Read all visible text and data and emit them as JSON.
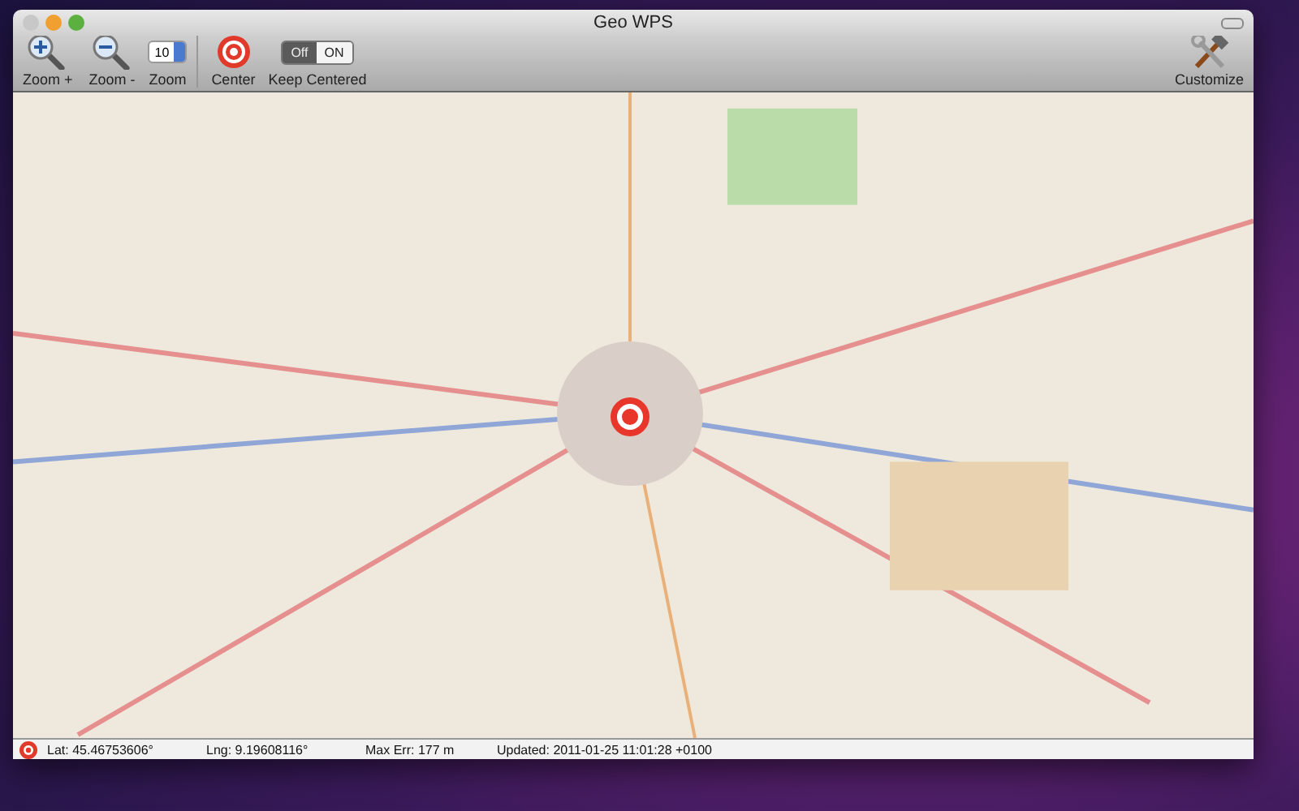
{
  "window": {
    "title": "Geo WPS"
  },
  "toolbar": {
    "items": [
      {
        "kind": "zoom-in",
        "label": "Zoom +"
      },
      {
        "kind": "zoom-out",
        "label": "Zoom -"
      },
      {
        "kind": "stepper",
        "label": "Zoom",
        "value": "10"
      },
      {
        "kind": "center",
        "label": "Center"
      },
      {
        "kind": "toggle",
        "label": "Keep Centered",
        "options": [
          {
            "label": "Off",
            "selected": true
          },
          {
            "label": "ON",
            "selected": false
          }
        ]
      }
    ],
    "customize": {
      "label": "Customize"
    }
  },
  "status_bar": {
    "lat": "Lat:  45.46753606°",
    "lng": "Lng:  9.19608116°",
    "error": "Max Err:  177 m",
    "updated": "Updated:  2011-01-25 11:01:28 +0100"
  }
}
